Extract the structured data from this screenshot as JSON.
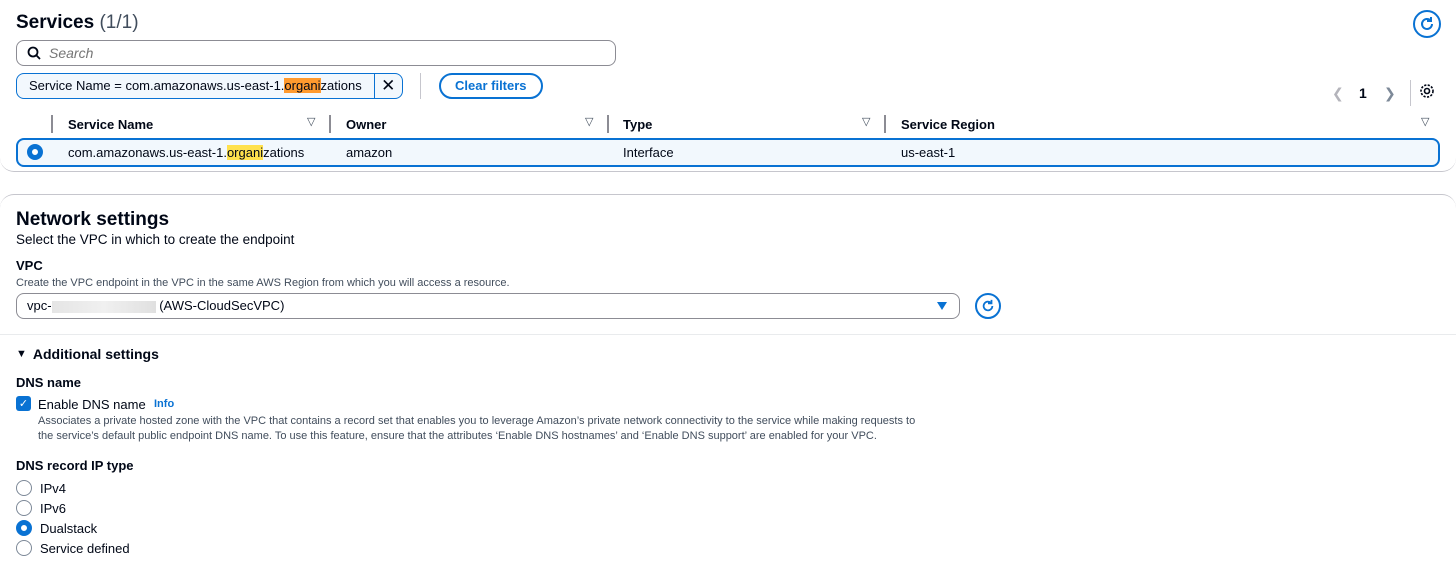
{
  "services": {
    "title": "Services",
    "count": "(1/1)",
    "search_placeholder": "Search",
    "filter_token_prefix": "Service Name = com.amazonaws.us-east-1.",
    "filter_token_hl": "organi",
    "filter_token_suffix": "zations",
    "clear_filters": "Clear filters",
    "page": "1",
    "columns": [
      "Service Name",
      "Owner",
      "Type",
      "Service Region"
    ],
    "row": {
      "name_prefix": "com.amazonaws.us-east-1.",
      "name_hl": "organi",
      "name_suffix": "zations",
      "owner": "amazon",
      "type": "Interface",
      "region": "us-east-1"
    }
  },
  "network": {
    "title": "Network settings",
    "subtitle": "Select the VPC in which to create the endpoint",
    "vpc_label": "VPC",
    "vpc_desc": "Create the VPC endpoint in the VPC in the same AWS Region from which you will access a resource.",
    "vpc_prefix": "vpc-",
    "vpc_suffix": "(AWS-CloudSecVPC)"
  },
  "additional": {
    "title": "Additional settings",
    "dns_name_label": "DNS name",
    "enable_dns": "Enable DNS name",
    "info": "Info",
    "dns_desc_1": "Associates a private hosted zone with the VPC that contains a record set that enables you to leverage Amazon’s private network connectivity to the service while making requests to",
    "dns_desc_2": "the service’s default public endpoint DNS name. To use this feature, ensure that the attributes ‘Enable DNS hostnames’ and ‘Enable DNS support’ are enabled for your VPC.",
    "ip_type_label": "DNS record IP type",
    "options": [
      "IPv4",
      "IPv6",
      "Dualstack",
      "Service defined"
    ],
    "selected": "Dualstack"
  },
  "colors": {
    "accent": "#0972d3",
    "highlight": "#ffe14d",
    "highlight_active": "#ff9a2e"
  }
}
